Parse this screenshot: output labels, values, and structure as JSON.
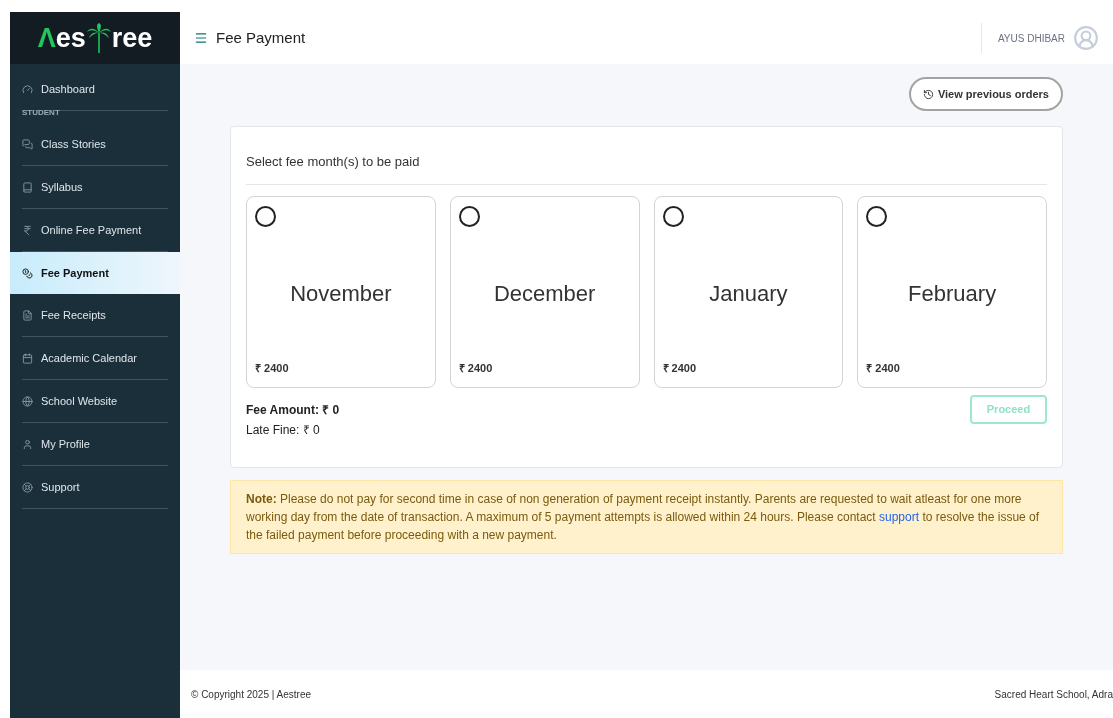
{
  "logo": {
    "left": "Λes",
    "right": "ree"
  },
  "sidebar": {
    "items": [
      {
        "kind": "item",
        "label": "Dashboard",
        "selected": false
      },
      {
        "kind": "heading",
        "label": "STUDENT"
      },
      {
        "kind": "item",
        "label": "Class Stories",
        "selected": false
      },
      {
        "kind": "item",
        "label": "Syllabus",
        "selected": false
      },
      {
        "kind": "item",
        "label": "Online Fee Payment",
        "selected": false
      },
      {
        "kind": "item",
        "label": "Fee Payment",
        "selected": true
      },
      {
        "kind": "item",
        "label": "Fee Receipts",
        "selected": false
      },
      {
        "kind": "item",
        "label": "Academic Calendar",
        "selected": false
      },
      {
        "kind": "item",
        "label": "School Website",
        "selected": false
      },
      {
        "kind": "item",
        "label": "My Profile",
        "selected": false
      },
      {
        "kind": "item",
        "label": "Support",
        "selected": false
      }
    ]
  },
  "header": {
    "title": "Fee Payment",
    "user": "AYUS DHIBAR"
  },
  "history_button": "View previous orders",
  "fee_panel": {
    "heading": "Select fee month(s) to be paid",
    "months": [
      {
        "name": "November",
        "amount": "₹ 2400",
        "selected": false
      },
      {
        "name": "December",
        "amount": "₹ 2400",
        "selected": false
      },
      {
        "name": "January",
        "amount": "₹ 2400",
        "selected": false
      },
      {
        "name": "February",
        "amount": "₹ 2400",
        "selected": false
      }
    ],
    "fee_amount": "Fee Amount: ₹ 0",
    "late_fine": "Late Fine: ₹ 0",
    "proceed": {
      "label": "Proceed",
      "disabled": true
    }
  },
  "note": {
    "text": "**Note:** Please do not pay for second time in case of non generation of payment receipt instantly. Parents are requested to wait atleast for one more working day from the date of transaction. A maximum of 5 payment attempts is allowed within 24 hours. Please contact",
    "link": "support",
    "after": "to resolve the issue of the failed payment before proceeding with a new payment."
  },
  "footer": {
    "copyright": "© Copyright 2025 | Aestree",
    "school": "Sacred Heart School, Adra"
  }
}
